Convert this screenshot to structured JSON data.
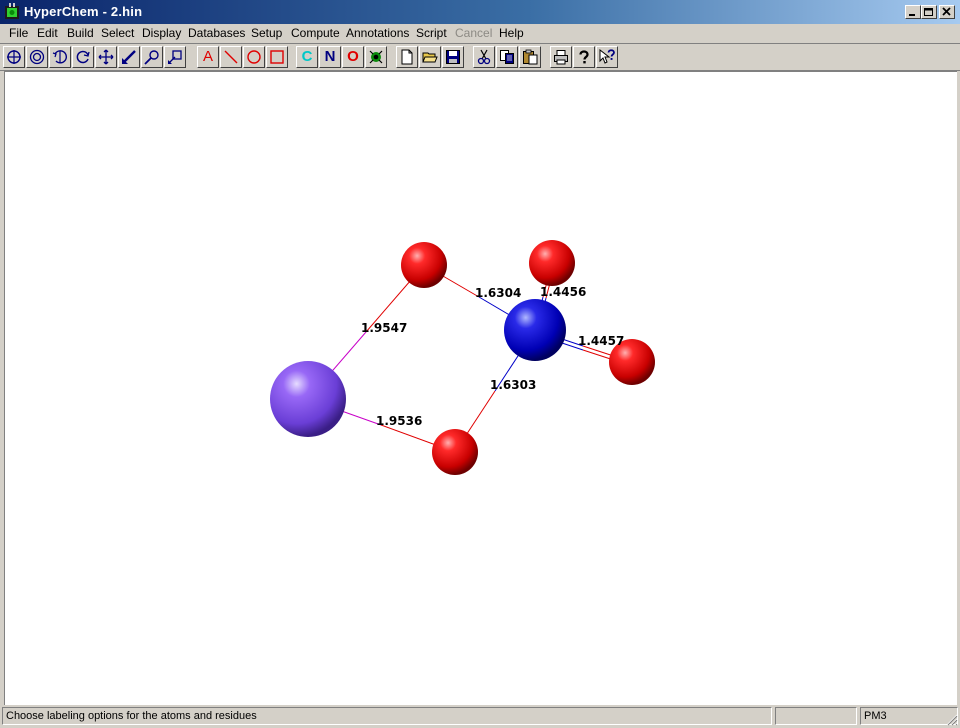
{
  "window": {
    "title": "HyperChem - 2.hin"
  },
  "window_controls": {
    "minimize": "_",
    "restore": "□",
    "close": "×"
  },
  "menu": [
    {
      "label": "File"
    },
    {
      "label": "Edit"
    },
    {
      "label": "Build"
    },
    {
      "label": "Select"
    },
    {
      "label": "Display"
    },
    {
      "label": "Databases"
    },
    {
      "label": "Setup"
    },
    {
      "label": "Compute"
    },
    {
      "label": "Annotations"
    },
    {
      "label": "Script"
    },
    {
      "label": "Cancel",
      "disabled": true
    },
    {
      "label": "Help"
    }
  ],
  "toolbar": {
    "tools": [
      "select-tool-icon",
      "zoom-tool-icon",
      "rotate-out-of-plane-icon",
      "rotate-in-plane-icon",
      "translate-icon",
      "draw-tool-icon",
      "zoom-out-icon",
      "z-translate-icon"
    ],
    "annotation_text_glyph": "A",
    "element_glyphs": {
      "carbon": "C",
      "nitrogen": "N",
      "oxygen": "O"
    },
    "colors": {
      "carbon": "#00d4d4",
      "nitrogen": "#000080",
      "oxygen": "#e00000",
      "annotation": "#e00000"
    }
  },
  "molecule": {
    "atoms": [
      {
        "id": "o-top",
        "element": "O",
        "color": "#e00000"
      },
      {
        "id": "o-upper-right",
        "element": "O",
        "color": "#e00000"
      },
      {
        "id": "n-center",
        "element": "N",
        "color": "#0000c8"
      },
      {
        "id": "o-right",
        "element": "O",
        "color": "#e00000"
      },
      {
        "id": "metal",
        "element": "K",
        "color": "#7a4de8"
      },
      {
        "id": "o-bottom",
        "element": "O",
        "color": "#e00000"
      }
    ],
    "bond_labels": {
      "o_top_n": "1.6304",
      "n_o_upper": "1.4456",
      "n_o_right": "1.4457",
      "metal_o_top": "1.9547",
      "n_o_bottom": "1.6303",
      "metal_o_bottom": "1.9536"
    }
  },
  "status": {
    "message": "Choose labeling options for the atoms and residues",
    "pane2": "",
    "method": "PM3"
  }
}
